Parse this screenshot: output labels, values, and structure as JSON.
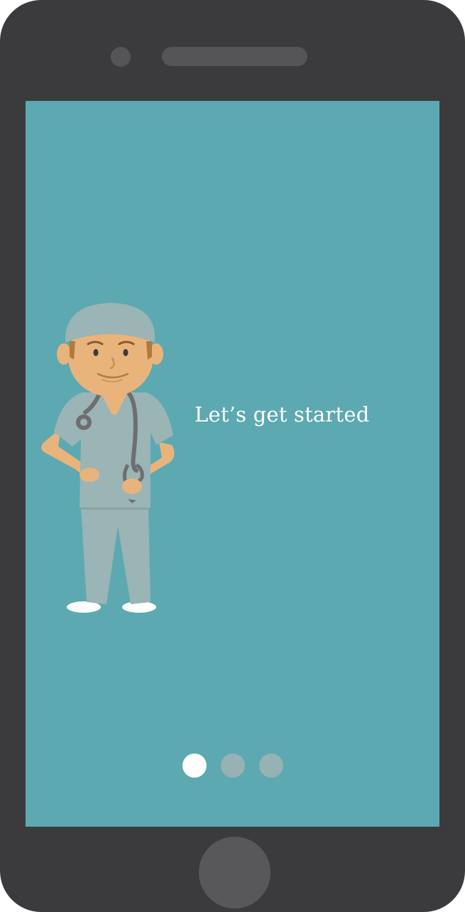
{
  "onboarding": {
    "headline": "Let’s get started",
    "illustration": "doctor-in-scrubs-with-stethoscope",
    "page_indicator": {
      "total_pages": 3,
      "current_page": 1
    }
  },
  "colors": {
    "device_body": "#3b3b3d",
    "screen_background": "#5ca9b1",
    "active_dot": "#ffffff",
    "inactive_dot": "#97b2b4",
    "scrubs": "#9bb4b6",
    "skin": "#e8b47c"
  },
  "icons": {
    "front_camera": "camera-dot",
    "speaker": "speaker-grille",
    "home_button": "home-circle"
  }
}
